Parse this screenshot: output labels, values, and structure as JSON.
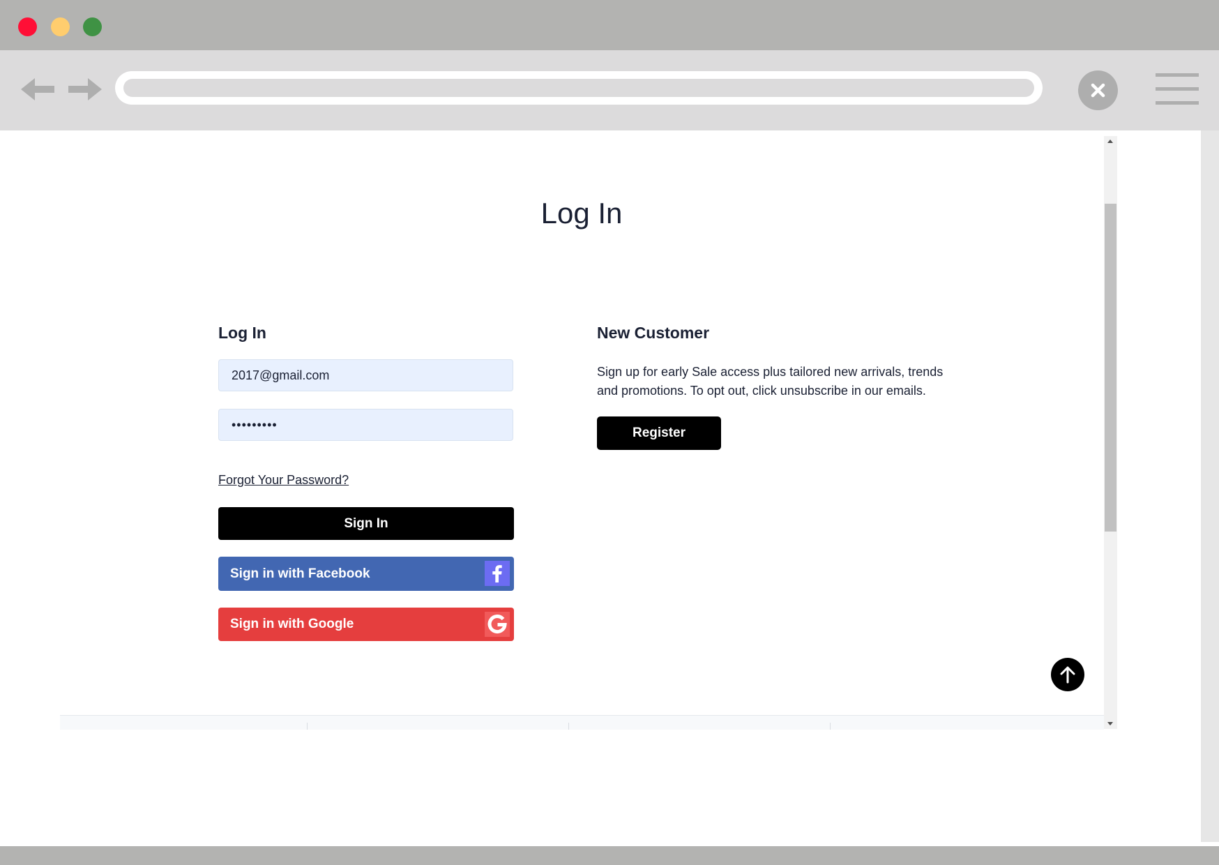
{
  "window": {
    "traffic_lights": [
      "close",
      "minimize",
      "maximize"
    ]
  },
  "toolbar": {
    "back_icon": "arrow-left-icon",
    "forward_icon": "arrow-right-icon",
    "close_icon": "close-icon",
    "menu_icon": "hamburger-menu-icon",
    "url": ""
  },
  "page": {
    "title": "Log In"
  },
  "login": {
    "heading": "Log In",
    "email_value": "2017@gmail.com",
    "password_value": "•••••••••",
    "forgot_password": "Forgot Your Password?",
    "sign_in": "Sign In",
    "facebook": "Sign in with Facebook",
    "facebook_icon": "facebook-icon",
    "google": "Sign in with Google",
    "google_icon": "google-icon"
  },
  "new_customer": {
    "heading": "New Customer",
    "description": "Sign up for early Sale access plus tailored new arrivals, trends and promotions. To opt out, click unsubscribe in our emails.",
    "register": "Register"
  },
  "back_to_top_icon": "arrow-up-icon",
  "colors": {
    "facebook": "#4267b2",
    "google": "#e53e3e",
    "primary_button": "#000000",
    "input_background": "#e8f0fe"
  }
}
